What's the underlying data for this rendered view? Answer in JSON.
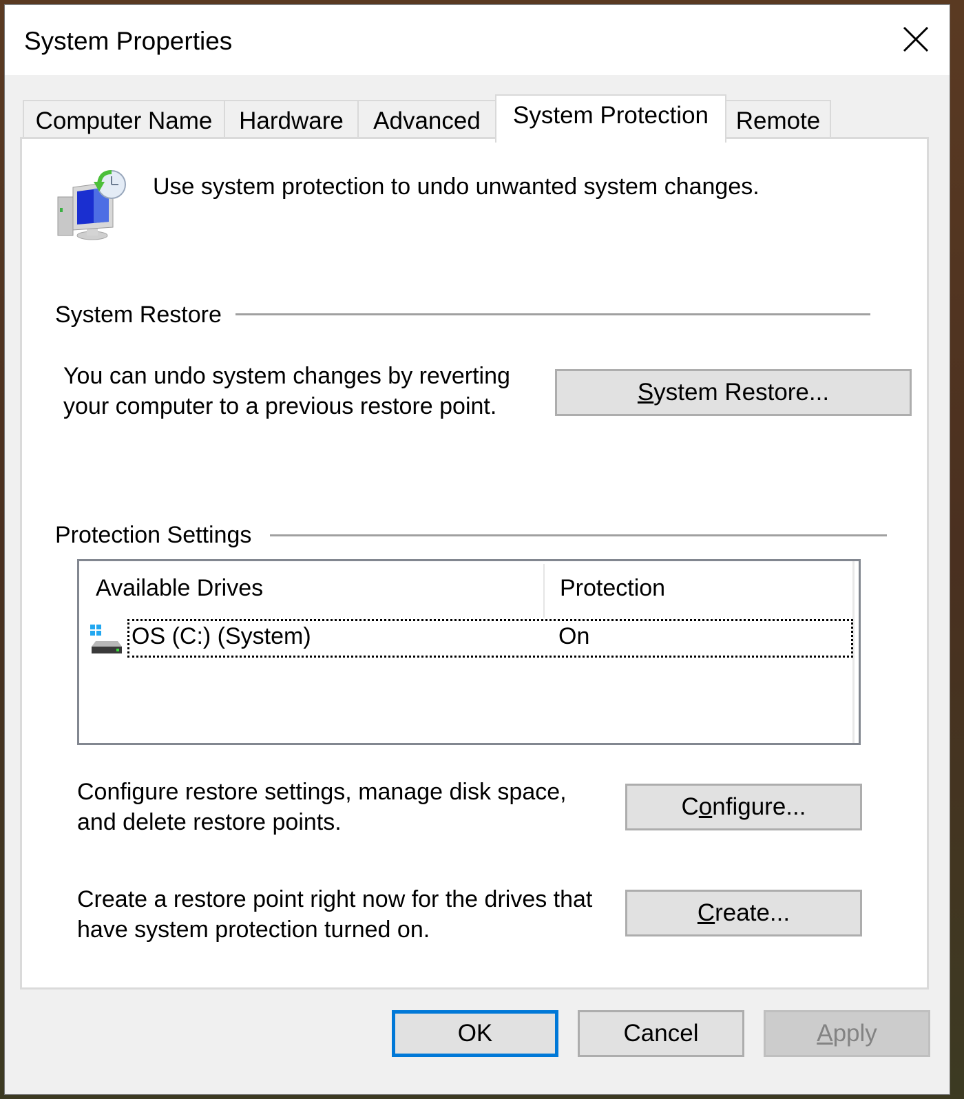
{
  "window": {
    "title": "System Properties",
    "close_icon": "close-icon"
  },
  "tabs": [
    {
      "label": "Computer Name",
      "active": false
    },
    {
      "label": "Hardware",
      "active": false
    },
    {
      "label": "Advanced",
      "active": false
    },
    {
      "label": "System Protection",
      "active": true
    },
    {
      "label": "Remote",
      "active": false
    }
  ],
  "panel": {
    "header_icon": "system-protection-icon",
    "intro_text": "Use system protection to undo unwanted system changes.",
    "system_restore": {
      "group_label": "System Restore",
      "description_line1": "You can undo system changes by reverting",
      "description_line2": "your computer to a previous restore point.",
      "button_label_mnemonic": "S",
      "button_label_rest": "ystem Restore..."
    },
    "protection_settings": {
      "group_label": "Protection Settings",
      "columns": [
        "Available Drives",
        "Protection"
      ],
      "drives": [
        {
          "icon": "windows-drive-icon",
          "name": "OS (C:) (System)",
          "protection": "On"
        }
      ],
      "configure": {
        "description_line1": "Configure restore settings, manage disk space,",
        "description_line2": "and delete restore points.",
        "button_label_pre": "C",
        "button_label_mnemonic": "o",
        "button_label_rest": "nfigure..."
      },
      "create": {
        "description_line1": "Create a restore point right now for the drives that",
        "description_line2": "have system protection turned on.",
        "button_label_mnemonic": "C",
        "button_label_rest": "reate..."
      }
    }
  },
  "footer": {
    "ok_label": "OK",
    "cancel_label": "Cancel",
    "apply_label_mnemonic": "A",
    "apply_label_rest": "pply",
    "apply_disabled": true
  },
  "colors": {
    "accent": "#0078d7",
    "button_bg": "#e1e1e1",
    "dialog_bg": "#f0f0f0"
  }
}
